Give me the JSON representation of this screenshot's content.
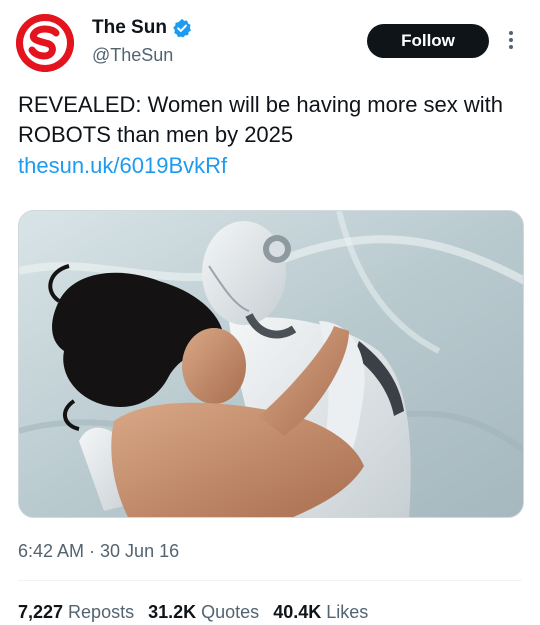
{
  "author": {
    "display_name": "The Sun",
    "handle": "@TheSun",
    "verified": true,
    "avatar_icon": "the-sun-logo",
    "brand_color": "#e3141d"
  },
  "follow_button": {
    "label": "Follow"
  },
  "more_menu": {
    "icon": "more-vertical-icon"
  },
  "tweet": {
    "text": "REVEALED: Women will be having more sex with ROBOTS than men by 2025",
    "link": "thesun.uk/6019BvkRf",
    "media_icon": "photo"
  },
  "timestamp": "6:42 AM · 30 Jun 16",
  "stats": [
    {
      "count": "7,227",
      "label": "Reposts"
    },
    {
      "count": "31.2K",
      "label": "Quotes"
    },
    {
      "count": "40.4K",
      "label": "Likes"
    }
  ],
  "colors": {
    "link": "#1d9bf0",
    "secondary_text": "#536471",
    "primary_text": "#0f1419"
  }
}
